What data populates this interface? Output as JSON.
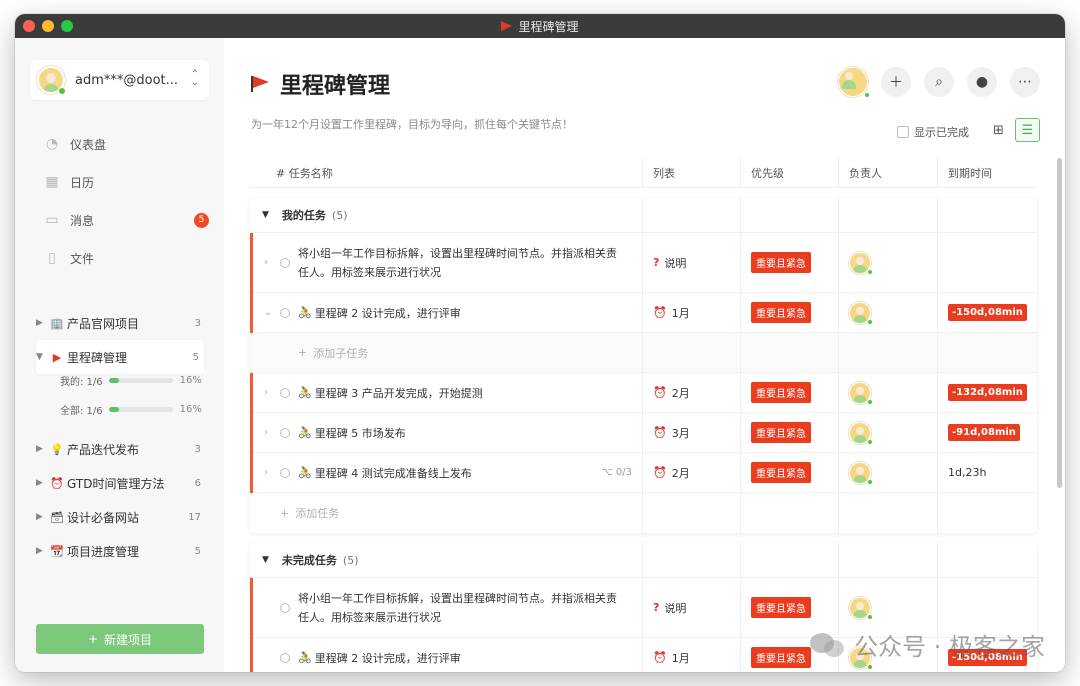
{
  "window": {
    "title": "里程碑管理"
  },
  "sidebar": {
    "account": "adm***@doot...",
    "nav": [
      {
        "label": "仪表盘",
        "icon": "dashboard-icon"
      },
      {
        "label": "日历",
        "icon": "calendar-icon"
      },
      {
        "label": "消息",
        "icon": "message-icon",
        "badge": "5"
      },
      {
        "label": "文件",
        "icon": "file-icon"
      }
    ],
    "projects": [
      {
        "label": "产品官网项目",
        "count": "3",
        "icon": "building-icon"
      },
      {
        "label": "里程碑管理",
        "count": "5",
        "icon": "flag-icon"
      },
      {
        "label": "产品迭代发布",
        "count": "3",
        "icon": "bulb-icon"
      },
      {
        "label": "GTD时间管理方法",
        "count": "6",
        "icon": "alarm-clock-icon"
      },
      {
        "label": "设计必备网站",
        "count": "17",
        "icon": "cabinet-icon"
      },
      {
        "label": "项目进度管理",
        "count": "5",
        "icon": "calendar-page-icon"
      }
    ],
    "progress": [
      {
        "label": "我的: 1/6",
        "pct": "16%",
        "value": 0.16
      },
      {
        "label": "全部: 1/6",
        "pct": "16%",
        "value": 0.16
      }
    ],
    "new_project": "新建项目"
  },
  "main": {
    "title": "里程碑管理",
    "subtitle": "为一年12个月设置工作里程碑，目标为导向，抓住每个关键节点！",
    "show_done": "显示已完成",
    "columns": {
      "name": "# 任务名称",
      "list": "列表",
      "priority": "优先级",
      "owner": "负责人",
      "due": "到期时间"
    },
    "groups": [
      {
        "title": "我的任务",
        "count": "(5)",
        "tasks": [
          {
            "name": "将小组一年工作目标拆解，设置出里程碑时间节点。并指派相关责任人。用标签来展示进行状况",
            "list": "说明",
            "list_icon": "?",
            "priority": "重要且紧急",
            "due": ""
          },
          {
            "name": "里程碑 2 设计完成，进行评审",
            "list": "1月",
            "list_icon": "⏰",
            "priority": "重要且紧急",
            "due": "-150d,08min"
          },
          {
            "name": "里程碑 3 产品开发完成，开始提测",
            "list": "2月",
            "list_icon": "⏰",
            "priority": "重要且紧急",
            "due": "-132d,08min"
          },
          {
            "name": "里程碑 5 市场发布",
            "list": "3月",
            "list_icon": "⏰",
            "priority": "重要且紧急",
            "due": "-91d,08min"
          },
          {
            "name": "里程碑 4 测试完成准备线上发布",
            "subtasks": "0/3",
            "list": "2月",
            "list_icon": "⏰",
            "priority": "重要且紧急",
            "due": "1d,23h"
          }
        ],
        "add_sub": "添加子任务",
        "add_task": "添加任务"
      },
      {
        "title": "未完成任务",
        "count": "(5)",
        "tasks": [
          {
            "name": "将小组一年工作目标拆解，设置出里程碑时间节点。并指派相关责任人。用标签来展示进行状况",
            "list": "说明",
            "list_icon": "?",
            "priority": "重要且紧急",
            "due": ""
          },
          {
            "name": "里程碑 2 设计完成，进行评审",
            "list": "1月",
            "list_icon": "⏰",
            "priority": "重要且紧急",
            "due": "-150d,08min"
          }
        ]
      }
    ]
  },
  "watermark": "公众号 · 极客之家",
  "colors": {
    "accent_red": "#ea3d1f",
    "accent_green": "#7cc97c"
  }
}
